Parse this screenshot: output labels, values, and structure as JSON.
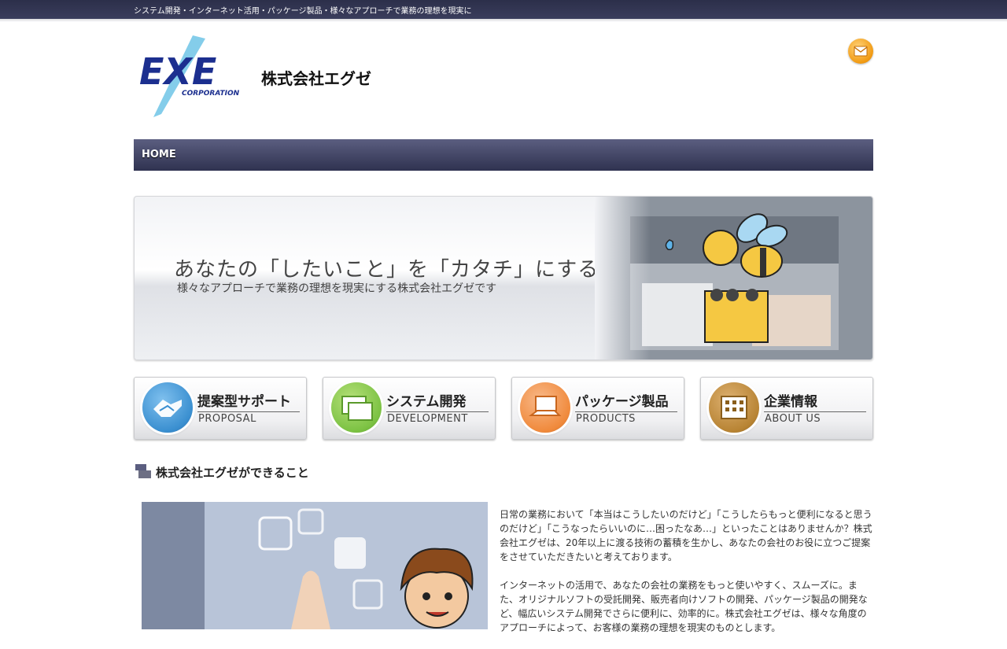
{
  "topbar": {
    "tagline": "システム開発・インターネット活用・パッケージ製品・様々なアプローチで業務の理想を現実に"
  },
  "header": {
    "logo_text": "EXE",
    "logo_subtext": "CORPORATION",
    "company_name": "株式会社エグゼ",
    "mail_icon": "mail-icon"
  },
  "nav": {
    "items": [
      {
        "label": "HOME"
      }
    ]
  },
  "hero": {
    "title": "あなたの「したいこと」を「カタチ」にする",
    "subtitle": "様々なアプローチで業務の理想を現実にする株式会社エグゼです"
  },
  "services": [
    {
      "title": "提案型サポート",
      "subtitle": "PROPOSAL",
      "color": "#3a8fd0",
      "icon": "handshake-icon"
    },
    {
      "title": "システム開発",
      "subtitle": "DEVELOPMENT",
      "color": "#7cc243",
      "icon": "windows-icon"
    },
    {
      "title": "パッケージ製品",
      "subtitle": "PRODUCTS",
      "color": "#f08a3c",
      "icon": "laptop-icon"
    },
    {
      "title": "企業情報",
      "subtitle": "ABOUT US",
      "color": "#b88434",
      "icon": "building-icon"
    }
  ],
  "section": {
    "title": "株式会社エグゼができること",
    "paragraphs": [
      "日常の業務において「本当はこうしたいのだけど」「こうしたらもっと便利になると思うのだけど」「こうなったらいいのに…困ったなあ…」といったことはありませんか？株式会社エグゼは、20年以上に渡る技術の蓄積を生かし、あなたの会社のお役に立つご提案をさせていただきたいと考えております。",
      "インターネットの活用で、あなたの会社の業務をもっと使いやすく、スムーズに。また、オリジナルソフトの受託開発、販売者向けソフトの開発、パッケージ製品の開発など、幅広いシステム開発でさらに便利に、効率的に。株式会社エグゼは、様々な角度のアプローチによって、お客様の業務の理想を現実のものとします。"
    ]
  },
  "colors": {
    "navy": "#2f3250",
    "accent_orange": "#f19a12",
    "logo_blue": "#1c2f8f"
  }
}
